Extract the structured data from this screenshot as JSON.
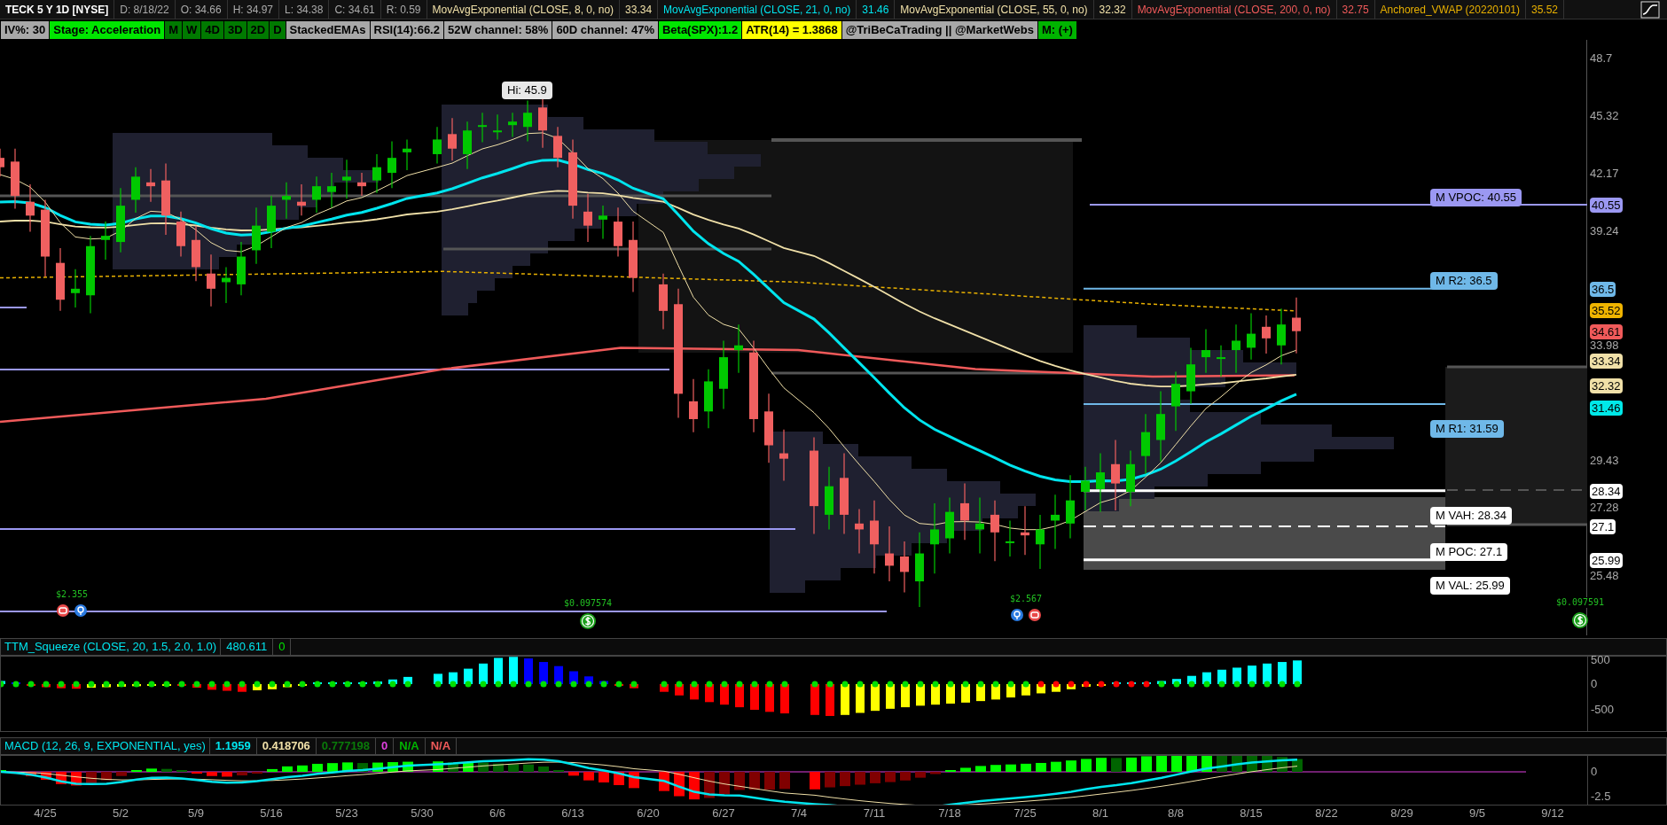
{
  "header": {
    "symbol": "TECK 5 Y 1D [NYSE]",
    "quotes": [
      {
        "text": "D: 8/18/22"
      },
      {
        "text": "O: 34.66"
      },
      {
        "text": "H: 34.97"
      },
      {
        "text": "L: 34.38"
      },
      {
        "text": "C: 34.61"
      },
      {
        "text": "R: 0.59"
      }
    ],
    "studies": [
      {
        "label": "MovAvgExponential (CLOSE, 8, 0, no)",
        "value": "33.34",
        "color": "#f0e0a8"
      },
      {
        "label": "MovAvgExponential (CLOSE, 21, 0, no)",
        "value": "31.46",
        "color": "#00e5ee"
      },
      {
        "label": "MovAvgExponential (CLOSE, 55, 0, no)",
        "value": "32.32",
        "color": "#f0e0a8"
      },
      {
        "label": "MovAvgExponential (CLOSE, 200, 0, no)",
        "value": "32.75",
        "color": "#f05a5a"
      },
      {
        "label": "Anchored_VWAP (20220101)",
        "value": "35.52",
        "color": "#e8b000"
      }
    ]
  },
  "labels": [
    {
      "text": "IV%: 30",
      "color": "#a8a8a8"
    },
    {
      "text": "Stage: Acceleration",
      "color": "#00e600"
    },
    {
      "text": "M",
      "color": "#007a00"
    },
    {
      "text": "W",
      "color": "#007a00"
    },
    {
      "text": "4D",
      "color": "#007a00"
    },
    {
      "text": "3D",
      "color": "#007a00"
    },
    {
      "text": "2D",
      "color": "#007a00"
    },
    {
      "text": "D",
      "color": "#007a00"
    },
    {
      "text": "StackedEMAs",
      "color": "#a8a8a8"
    },
    {
      "text": "RSI(14):66.2",
      "color": "#a8a8a8"
    },
    {
      "text": "52W channel: 58%",
      "color": "#a8a8a8"
    },
    {
      "text": "60D channel: 47%",
      "color": "#a8a8a8"
    },
    {
      "text": "Beta(SPX):1.2",
      "color": "#00e600"
    },
    {
      "text": "ATR(14) = 1.3868",
      "color": "#ffff00"
    },
    {
      "text": "@TriBeCaTrading || @MarketWebs",
      "color": "#a8a8a8"
    },
    {
      "text": "M: (+)",
      "color": "#00b400"
    }
  ],
  "hi_label": "Hi: 45.9",
  "levels": [
    {
      "text": "M VPOC: 40.55",
      "color": "#9b98f2"
    },
    {
      "text": "M R2: 36.5",
      "color": "#6fb8e8"
    },
    {
      "text": "M R1: 31.59",
      "color": "#6fb8e8"
    },
    {
      "text": "M VAH: 28.34",
      "color": "#ffffff"
    },
    {
      "text": "M POC: 27.1",
      "color": "#ffffff"
    },
    {
      "text": "M VAL: 25.99",
      "color": "#ffffff"
    }
  ],
  "events": [
    {
      "text": "$2.355"
    },
    {
      "text": "$0.097574"
    },
    {
      "text": "$2.567"
    },
    {
      "text": "$0.097591"
    }
  ],
  "price_axis": {
    "ticks": [
      "48.7",
      "45.32",
      "42.17",
      "39.24",
      "33.98",
      "29.43",
      "27.28",
      "25.48"
    ],
    "badges": [
      {
        "text": "40.55",
        "color": "#9b98f2"
      },
      {
        "text": "36.5",
        "color": "#6fb8e8"
      },
      {
        "text": "35.52",
        "color": "#f0b400"
      },
      {
        "text": "34.61",
        "color": "#f05a5a"
      },
      {
        "text": "33.34",
        "color": "#f0e0a8"
      },
      {
        "text": "32.32",
        "color": "#f0e0a8"
      },
      {
        "text": "31.46",
        "color": "#00e8e8"
      },
      {
        "text": "28.34",
        "color": "#ffffff"
      },
      {
        "text": "27.1",
        "color": "#ffffff"
      },
      {
        "text": "25.99",
        "color": "#ffffff"
      }
    ]
  },
  "squeeze": {
    "title": "TTM_Squeeze (CLOSE, 20, 1.5, 2.0, 1.0)",
    "values": [
      {
        "text": "480.611",
        "color": "#00e5ee"
      },
      {
        "text": "0",
        "color": "#00e600"
      }
    ],
    "ticks": [
      "500",
      "0",
      "-500"
    ]
  },
  "macd": {
    "title": "MACD (12, 26, 9, EXPONENTIAL, yes)",
    "values": [
      {
        "text": "1.1959",
        "color": "#00e5ee"
      },
      {
        "text": "0.418706",
        "color": "#f0e0a8"
      },
      {
        "text": "0.777198",
        "color": "#0a7a0a"
      },
      {
        "text": "0",
        "color": "#e040e0"
      },
      {
        "text": "N/A",
        "color": "#00b400"
      },
      {
        "text": "N/A",
        "color": "#f05a5a"
      }
    ],
    "ticks": [
      "0",
      "-2.5"
    ]
  },
  "dates": [
    "4/25",
    "5/2",
    "5/9",
    "5/16",
    "5/23",
    "5/30",
    "6/6",
    "6/13",
    "6/20",
    "6/27",
    "7/4",
    "7/11",
    "7/18",
    "7/25",
    "8/1",
    "8/8",
    "8/15",
    "8/22",
    "8/29",
    "9/5",
    "9/12"
  ]
}
